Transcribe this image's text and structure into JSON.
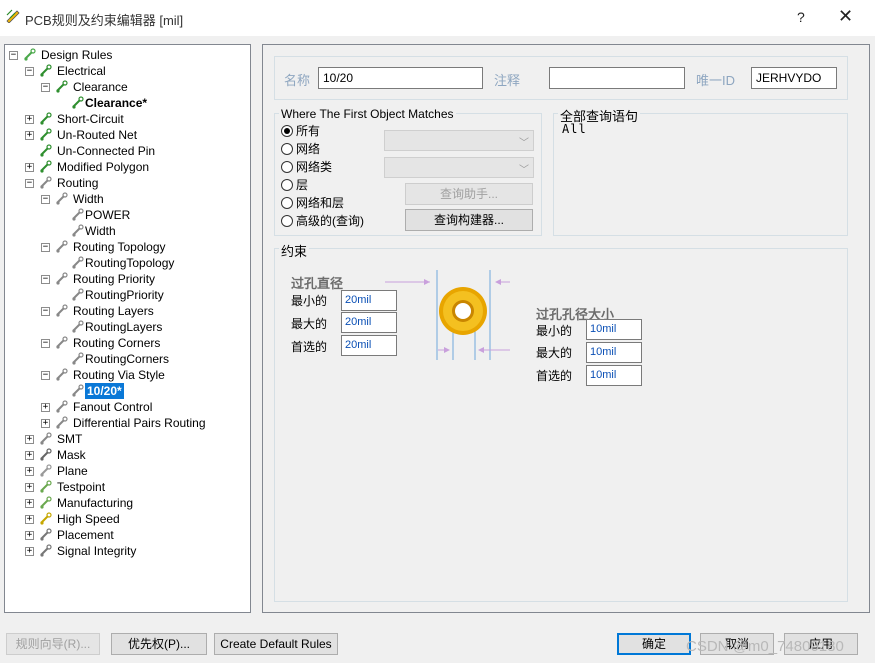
{
  "window": {
    "title": "PCB规则及约束编辑器 [mil]",
    "help": "?",
    "close": "✕"
  },
  "tree": {
    "items": [
      {
        "label": "Design Rules",
        "expander": "−",
        "icon": "design-rules-icon"
      },
      {
        "label": "Electrical",
        "expander": "−",
        "icon": "electrical-icon"
      },
      {
        "label": "Clearance",
        "expander": "−",
        "icon": "clearance-icon"
      },
      {
        "label": "Clearance*",
        "expander": "",
        "icon": "rule-icon",
        "bold": true
      },
      {
        "label": "Short-Circuit",
        "expander": "+",
        "icon": "short-circuit-icon"
      },
      {
        "label": "Un-Routed Net",
        "expander": "+",
        "icon": "unrouted-net-icon"
      },
      {
        "label": "Un-Connected Pin",
        "expander": "",
        "icon": "unconnected-pin-icon"
      },
      {
        "label": "Modified Polygon",
        "expander": "+",
        "icon": "modified-polygon-icon"
      },
      {
        "label": "Routing",
        "expander": "−",
        "icon": "routing-icon"
      },
      {
        "label": "Width",
        "expander": "−",
        "icon": "width-icon"
      },
      {
        "label": "POWER",
        "expander": "",
        "icon": "rule-icon"
      },
      {
        "label": "Width",
        "expander": "",
        "icon": "rule-icon"
      },
      {
        "label": "Routing Topology",
        "expander": "−",
        "icon": "routing-topology-icon"
      },
      {
        "label": "RoutingTopology",
        "expander": "",
        "icon": "rule-icon"
      },
      {
        "label": "Routing Priority",
        "expander": "−",
        "icon": "routing-priority-icon"
      },
      {
        "label": "RoutingPriority",
        "expander": "",
        "icon": "rule-icon"
      },
      {
        "label": "Routing Layers",
        "expander": "−",
        "icon": "routing-layers-icon"
      },
      {
        "label": "RoutingLayers",
        "expander": "",
        "icon": "rule-icon"
      },
      {
        "label": "Routing Corners",
        "expander": "−",
        "icon": "routing-corners-icon"
      },
      {
        "label": "RoutingCorners",
        "expander": "",
        "icon": "rule-icon"
      },
      {
        "label": "Routing Via Style",
        "expander": "−",
        "icon": "routing-via-style-icon"
      },
      {
        "label": "10/20*",
        "expander": "",
        "icon": "rule-icon",
        "selected": true
      },
      {
        "label": "Fanout Control",
        "expander": "+",
        "icon": "fanout-control-icon"
      },
      {
        "label": "Differential Pairs Routing",
        "expander": "+",
        "icon": "diff-pairs-icon"
      },
      {
        "label": "SMT",
        "expander": "+",
        "icon": "smt-icon"
      },
      {
        "label": "Mask",
        "expander": "+",
        "icon": "mask-icon"
      },
      {
        "label": "Plane",
        "expander": "+",
        "icon": "plane-icon"
      },
      {
        "label": "Testpoint",
        "expander": "+",
        "icon": "testpoint-icon"
      },
      {
        "label": "Manufacturing",
        "expander": "+",
        "icon": "manufacturing-icon"
      },
      {
        "label": "High Speed",
        "expander": "+",
        "icon": "high-speed-icon"
      },
      {
        "label": "Placement",
        "expander": "+",
        "icon": "placement-icon"
      },
      {
        "label": "Signal Integrity",
        "expander": "+",
        "icon": "signal-integrity-icon"
      }
    ]
  },
  "header": {
    "name_label": "名称",
    "name_value": "10/20",
    "comment_label": "注释",
    "comment_value": "",
    "uid_label": "唯一ID",
    "uid_value": "JERHVYDO"
  },
  "match": {
    "title": "Where The First Object Matches",
    "options": [
      "所有",
      "网络",
      "网络类",
      "层",
      "网络和层",
      "高级的(查询)"
    ],
    "selected": "所有",
    "query_helper": "查询助手...",
    "query_builder": "查询构建器..."
  },
  "full_query": {
    "title": "全部查询语句",
    "text": "All"
  },
  "constraints": {
    "title": "约束",
    "via_diameter": {
      "title": "过孔直径",
      "min_label": "最小的",
      "min": "20mil",
      "max_label": "最大的",
      "max": "20mil",
      "pref_label": "首选的",
      "pref": "20mil"
    },
    "hole_size": {
      "title": "过孔孔径大小",
      "min_label": "最小的",
      "min": "10mil",
      "max_label": "最大的",
      "max": "10mil",
      "pref_label": "首选的",
      "pref": "10mil"
    },
    "via_color": "#f2b705"
  },
  "buttons": {
    "rule_wizard": "规则向导(R)...",
    "priorities": "优先权(P)...",
    "create_default": "Create Default Rules",
    "ok": "确定",
    "cancel": "取消",
    "apply": "应用"
  },
  "watermark": "CSDN @m0_74800180"
}
